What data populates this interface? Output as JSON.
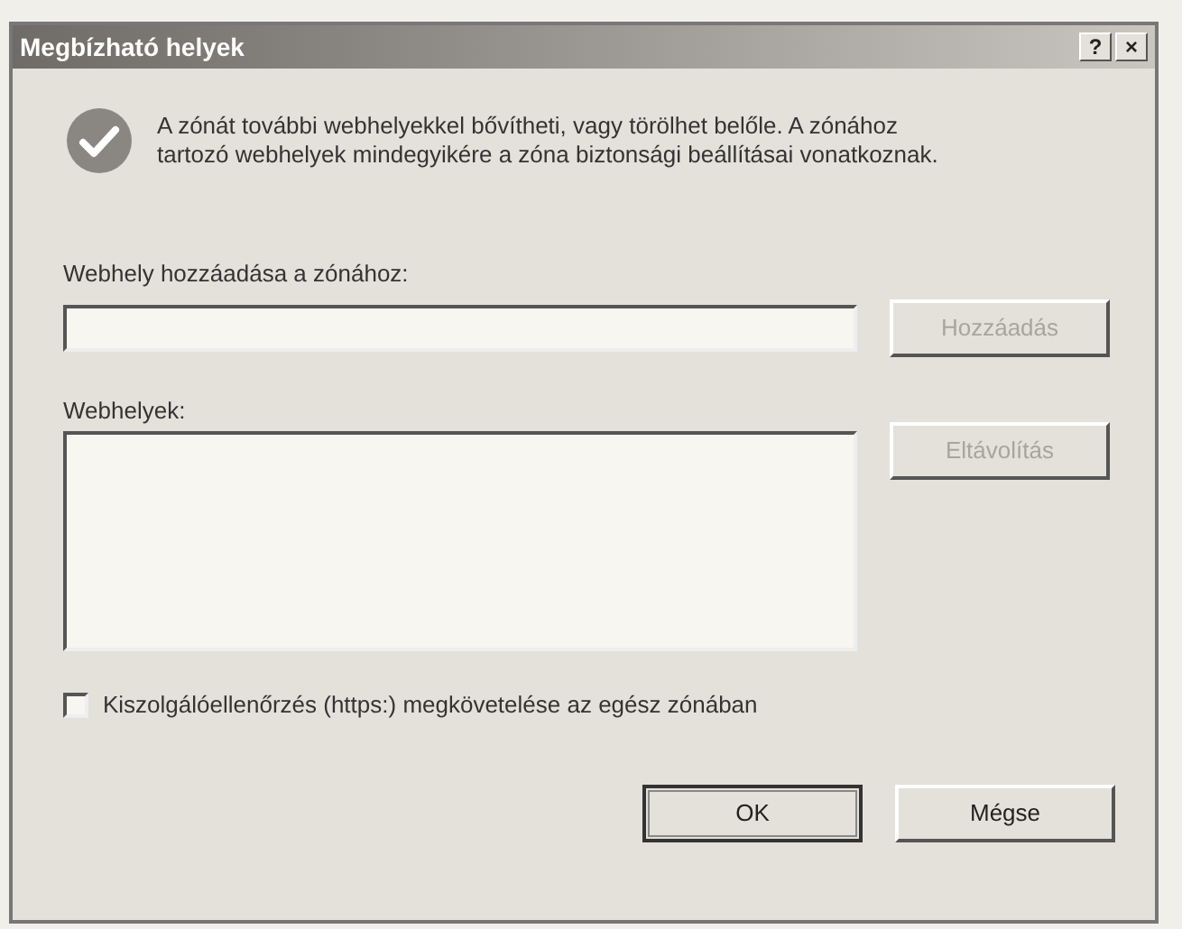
{
  "window": {
    "title": "Megbízható helyek",
    "title_buttons": [
      "?",
      "×"
    ]
  },
  "intro": "A zónát további webhelyekkel bővítheti, vagy törölhet belőle. A zónához tartozó webhelyek mindegyikére a zóna biztonsági beállításai vonatkoznak.",
  "add_field": {
    "label": "Webhely hozzáadása a zónához:"
  },
  "add_button": {
    "label": "Hozzáadás",
    "disabled": true
  },
  "sites": {
    "label": "Webhelyek:"
  },
  "remove_button": {
    "label": "Eltávolítás",
    "disabled": true
  },
  "https_checkbox": {
    "label": "Kiszolgálóellenőrzés (https:) megkövetelése az egész zónában",
    "checked": false
  },
  "buttons": [
    {
      "label": "OK",
      "default": true
    },
    {
      "label": "Mégse",
      "default": false
    }
  ]
}
